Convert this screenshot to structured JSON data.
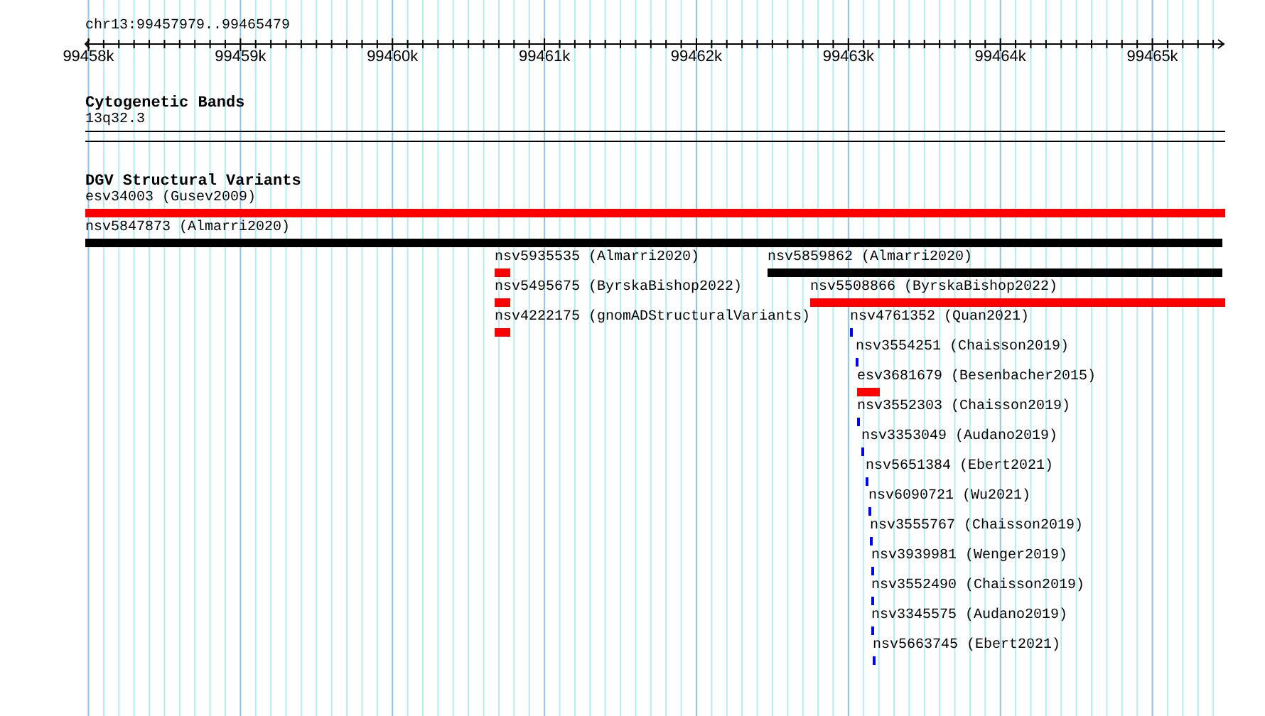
{
  "ruler": {
    "location": "chr13:99457979..99465479",
    "ticks": [
      "99458k",
      "99459k",
      "99460k",
      "99461k",
      "99462k",
      "99463k",
      "99464k",
      "99465k"
    ]
  },
  "tracks": [
    {
      "kind": "bands",
      "title": "Cytogenetic Bands",
      "bands": [
        {
          "name": "13q32.3"
        }
      ]
    },
    {
      "kind": "features",
      "title": "DGV Structural Variants",
      "features": [
        {
          "label": "esv34003 (Gusev2009)",
          "color": "#ff0000"
        },
        {
          "label": "nsv5847873 (Almarri2020)",
          "color": "#000000"
        },
        {
          "label": "nsv5935535 (Almarri2020)",
          "color": "#ff0000"
        },
        {
          "label": "nsv5859862 (Almarri2020)",
          "color": "#000000"
        },
        {
          "label": "nsv5495675 (ByrskaBishop2022)",
          "color": "#ff0000"
        },
        {
          "label": "nsv5508866 (ByrskaBishop2022)",
          "color": "#ff0000"
        },
        {
          "label": "nsv4222175 (gnomADStructuralVariants)",
          "color": "#ff0000"
        },
        {
          "label": "nsv4761352 (Quan2021)",
          "color": "#0000ff"
        },
        {
          "label": "nsv3554251 (Chaisson2019)",
          "color": "#0000ff"
        },
        {
          "label": "esv3681679 (Besenbacher2015)",
          "color": "#ff0000"
        },
        {
          "label": "nsv3552303 (Chaisson2019)",
          "color": "#0000ff"
        },
        {
          "label": "nsv3353049 (Audano2019)",
          "color": "#0000ff"
        },
        {
          "label": "nsv5651384 (Ebert2021)",
          "color": "#0000ff"
        },
        {
          "label": "nsv6090721 (Wu2021)",
          "color": "#0000ff"
        },
        {
          "label": "nsv3555767 (Chaisson2019)",
          "color": "#0000ff"
        },
        {
          "label": "nsv3939981 (Wenger2019)",
          "color": "#0000ff"
        },
        {
          "label": "nsv3552490 (Chaisson2019)",
          "color": "#0000ff"
        },
        {
          "label": "nsv3345575 (Audano2019)",
          "color": "#0000ff"
        },
        {
          "label": "nsv5663745 (Ebert2021)",
          "color": "#0000ff"
        }
      ]
    }
  ]
}
